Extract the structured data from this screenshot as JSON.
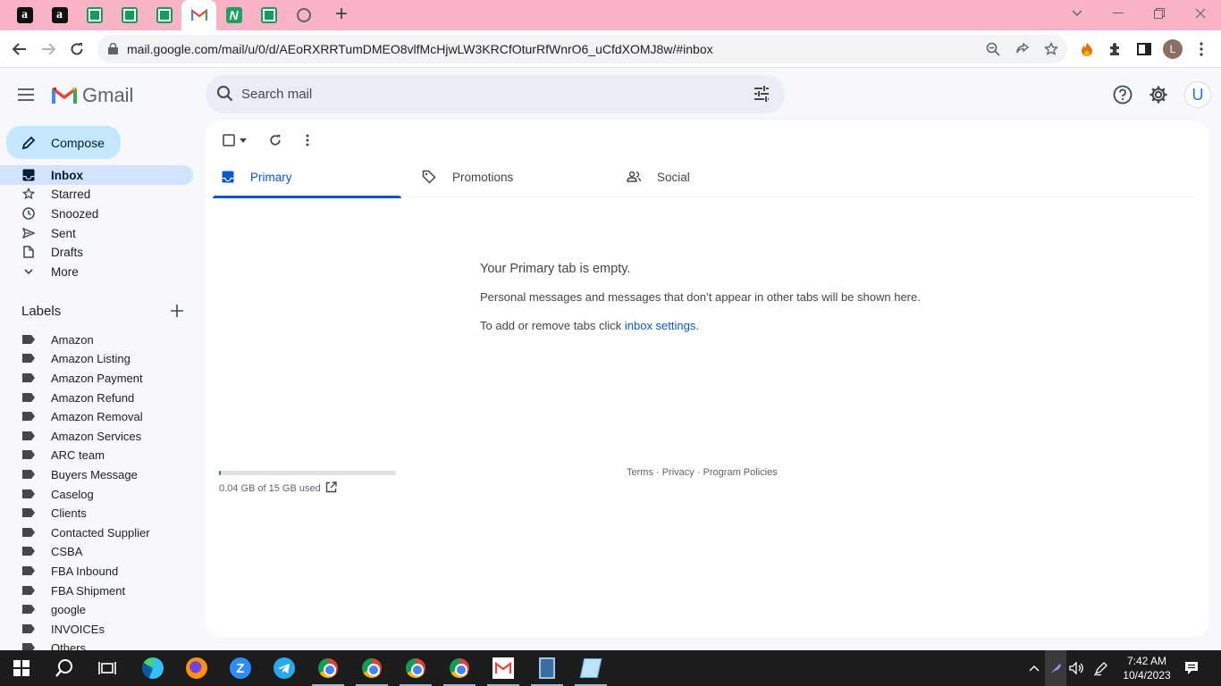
{
  "browser": {
    "url": "mail.google.com/mail/u/0/d/AEoRXRRTumDMEO8vlfMcHjwLW3KRCfOturRfWnrO6_uCfdXOMJ8w/#inbox",
    "profile_initial": "L",
    "tabs": [
      {
        "icon": "amazon-icon",
        "glyph": "a"
      },
      {
        "icon": "amazon-icon",
        "glyph": "a"
      },
      {
        "icon": "sheets-icon",
        "glyph": ""
      },
      {
        "icon": "sheets-icon",
        "glyph": ""
      },
      {
        "icon": "sheets-icon",
        "glyph": ""
      },
      {
        "icon": "gmail-icon",
        "glyph": "M",
        "active": true
      },
      {
        "icon": "nw-icon",
        "glyph": "N"
      },
      {
        "icon": "sheets-icon",
        "glyph": ""
      },
      {
        "icon": "globe-icon",
        "glyph": ""
      }
    ]
  },
  "gmail": {
    "logo_text": "Gmail",
    "search_placeholder": "Search mail",
    "avatar_initial": "U",
    "compose_label": "Compose",
    "nav": [
      {
        "label": "Inbox",
        "icon": "inbox-icon",
        "active": true
      },
      {
        "label": "Starred",
        "icon": "star-icon"
      },
      {
        "label": "Snoozed",
        "icon": "clock-icon"
      },
      {
        "label": "Sent",
        "icon": "send-icon"
      },
      {
        "label": "Drafts",
        "icon": "draft-icon"
      },
      {
        "label": "More",
        "icon": "chevron-down-icon"
      }
    ],
    "labels_title": "Labels",
    "labels": [
      "Amazon",
      "Amazon Listing",
      "Amazon Payment",
      "Amazon Refund",
      "Amazon Removal",
      "Amazon Services",
      "ARC team",
      "Buyers Message",
      "Caselog",
      "Clients",
      "Contacted Supplier",
      "CSBA",
      "FBA Inbound",
      "FBA Shipment",
      "google",
      "INVOICEs",
      "Others"
    ],
    "tabs": [
      {
        "label": "Primary",
        "icon": "inbox-icon",
        "active": true
      },
      {
        "label": "Promotions",
        "icon": "tag-icon"
      },
      {
        "label": "Social",
        "icon": "people-icon"
      }
    ],
    "empty": {
      "title": "Your Primary tab is empty.",
      "description": "Personal messages and messages that don’t appear in other tabs will be shown here.",
      "settings_prefix": "To add or remove tabs click ",
      "settings_link": "inbox settings",
      "settings_suffix": "."
    },
    "storage": {
      "text": "0.04 GB of 15 GB used",
      "fraction_used": 0.003
    },
    "footer": "Terms · Privacy · Program Policies"
  },
  "taskbar": {
    "time": "7:42 AM",
    "date": "10/4/2023"
  },
  "colors": {
    "tabstrip": "#f8b4c4",
    "accent": "#0b57d0",
    "compose": "#c2e7ff",
    "active_nav": "#d3e3fd"
  }
}
